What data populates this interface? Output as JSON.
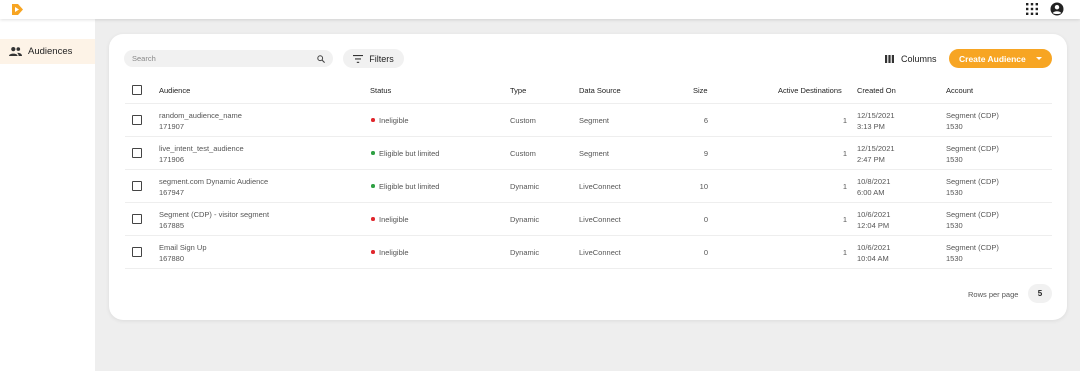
{
  "colors": {
    "accent": "#f7a523",
    "ineligible": "#e0262c",
    "eligible": "#2ea043"
  },
  "topbar": {
    "logo": "brand-logo",
    "apps_icon": "apps-grid-icon",
    "account_icon": "account-circle-icon"
  },
  "sidebar": {
    "items": [
      {
        "label": "Audiences",
        "icon": "people-icon",
        "active": true
      }
    ]
  },
  "toolbar": {
    "search_placeholder": "Search",
    "filters_label": "Filters",
    "columns_label": "Columns",
    "create_label": "Create Audience"
  },
  "table": {
    "headers": [
      "Audience",
      "Status",
      "Type",
      "Data Source",
      "Size",
      "Active Destinations",
      "Created On",
      "Account"
    ],
    "rows": [
      {
        "name": "random_audience_name",
        "id": "171907",
        "status": "Ineligible",
        "status_color": "red",
        "type": "Custom",
        "source": "Segment",
        "size": "6",
        "active": "1",
        "date": "12/15/2021",
        "time": "3:13 PM",
        "account": "Segment (CDP)",
        "account_id": "1530"
      },
      {
        "name": "live_intent_test_audience",
        "id": "171906",
        "status": "Eligible but limited",
        "status_color": "green",
        "type": "Custom",
        "source": "Segment",
        "size": "9",
        "active": "1",
        "date": "12/15/2021",
        "time": "2:47 PM",
        "account": "Segment (CDP)",
        "account_id": "1530"
      },
      {
        "name": "segment.com Dynamic Audience",
        "id": "167947",
        "status": "Eligible but limited",
        "status_color": "green",
        "type": "Dynamic",
        "source": "LiveConnect",
        "size": "10",
        "active": "1",
        "date": "10/8/2021",
        "time": "6:00 AM",
        "account": "Segment (CDP)",
        "account_id": "1530"
      },
      {
        "name": "Segment (CDP) - visitor segment",
        "id": "167885",
        "status": "Ineligible",
        "status_color": "red",
        "type": "Dynamic",
        "source": "LiveConnect",
        "size": "0",
        "active": "1",
        "date": "10/6/2021",
        "time": "12:04 PM",
        "account": "Segment (CDP)",
        "account_id": "1530"
      },
      {
        "name": "Email Sign Up",
        "id": "167880",
        "status": "Ineligible",
        "status_color": "red",
        "type": "Dynamic",
        "source": "LiveConnect",
        "size": "0",
        "active": "1",
        "date": "10/6/2021",
        "time": "10:04 AM",
        "account": "Segment (CDP)",
        "account_id": "1530"
      }
    ]
  },
  "pagination": {
    "rows_per_page_label": "Rows per page",
    "rows_per_page_value": "5"
  }
}
